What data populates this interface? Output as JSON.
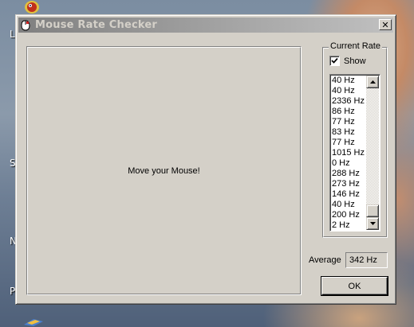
{
  "window": {
    "title": "Mouse Rate Checker",
    "close_label": "✕"
  },
  "test_area": {
    "prompt": "Move your Mouse!"
  },
  "current_rate": {
    "group_label": "Current Rate",
    "show_label": "Show",
    "show_checked": true,
    "rates": [
      "40 Hz",
      "40 Hz",
      "2336 Hz",
      "86 Hz",
      "77 Hz",
      "83 Hz",
      "77 Hz",
      "1015 Hz",
      "0 Hz",
      "288 Hz",
      "273 Hz",
      "146 Hz",
      "40 Hz",
      "200 Hz",
      "2 Hz"
    ],
    "scroll_position": 1.0
  },
  "average": {
    "label": "Average",
    "value": "342 Hz"
  },
  "ok_button": {
    "label": "OK"
  },
  "desktop": {
    "letters": [
      "L",
      "S",
      "N",
      "P"
    ]
  },
  "colors": {
    "dialog_face": "#d4d0c8",
    "titlebar_inactive_start": "#808080",
    "titlebar_inactive_end": "#c0c0c0"
  }
}
